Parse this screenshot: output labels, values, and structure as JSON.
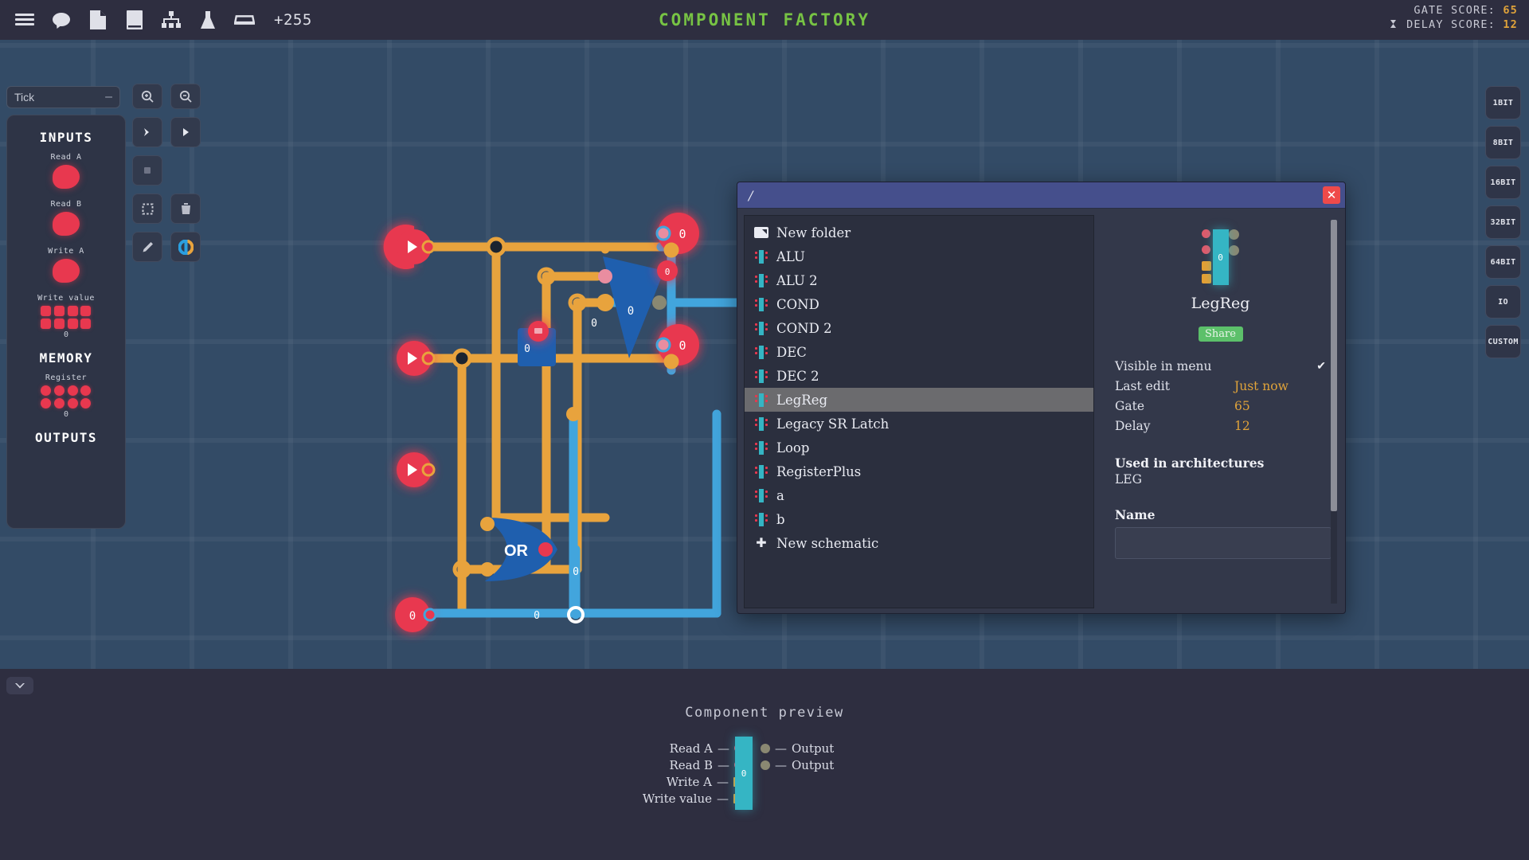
{
  "topbar": {
    "icons": [
      {
        "name": "menu-icon",
        "label": "Menu"
      },
      {
        "name": "chat-icon",
        "label": "Chat"
      },
      {
        "name": "file-icon",
        "label": "File"
      },
      {
        "name": "book-icon",
        "label": "Book"
      },
      {
        "name": "hierarchy-icon",
        "label": "Architecture"
      },
      {
        "name": "flask-icon",
        "label": "Lab"
      },
      {
        "name": "tray-icon",
        "label": "Tray"
      }
    ],
    "tray_count": "+255",
    "app_title": "COMPONENT FACTORY",
    "gate_score_label": "GATE SCORE:",
    "gate_score_value": "65",
    "delay_score_label": "DELAY SCORE:",
    "delay_score_value": "12"
  },
  "sim_panel": {
    "mode_select_value": "Tick",
    "mode_select_marker": "–",
    "inputs_title": "INPUTS",
    "memory_title": "MEMORY",
    "outputs_title": "OUTPUTS",
    "inputs": [
      {
        "label": "Read A",
        "type": "bulb"
      },
      {
        "label": "Read B",
        "type": "bulb"
      },
      {
        "label": "Write A",
        "type": "bulb"
      }
    ],
    "write_value": {
      "label": "Write value",
      "bits": 8,
      "value": "0"
    },
    "register": {
      "label": "Register",
      "bits": 8,
      "value": "0"
    }
  },
  "tools": [
    {
      "name": "zoom-in-icon",
      "label": "Zoom in"
    },
    {
      "name": "zoom-out-icon",
      "label": "Zoom out"
    },
    {
      "name": "step-icon",
      "label": "Step"
    },
    {
      "name": "play-icon",
      "label": "Play"
    },
    {
      "name": "stop-icon",
      "label": "Stop"
    },
    {
      "name": "select-icon",
      "label": "Select"
    },
    {
      "name": "delete-icon",
      "label": "Delete"
    },
    {
      "name": "pencil-icon",
      "label": "Draw"
    },
    {
      "name": "color-ring-icon",
      "label": "Color"
    }
  ],
  "bit_buttons": [
    "1BIT",
    "8BIT",
    "16BIT",
    "32BIT",
    "64BIT",
    "IO",
    "CUSTOM"
  ],
  "dialog": {
    "path": "/",
    "close_label": "✕",
    "files": [
      {
        "label": "New folder",
        "icon": "folder-icon",
        "selected": false
      },
      {
        "label": "ALU",
        "icon": "chip-icon",
        "selected": false
      },
      {
        "label": "ALU 2",
        "icon": "chip-icon",
        "selected": false
      },
      {
        "label": "COND",
        "icon": "chip-icon",
        "selected": false
      },
      {
        "label": "COND 2",
        "icon": "chip-icon",
        "selected": false
      },
      {
        "label": "DEC",
        "icon": "chip-icon",
        "selected": false
      },
      {
        "label": "DEC 2",
        "icon": "chip-icon",
        "selected": false
      },
      {
        "label": "LegReg",
        "icon": "chip-icon",
        "selected": true
      },
      {
        "label": "Legacy SR Latch",
        "icon": "chip-icon",
        "selected": false
      },
      {
        "label": "Loop",
        "icon": "chip-icon",
        "selected": false
      },
      {
        "label": "RegisterPlus",
        "icon": "chip-icon",
        "selected": false
      },
      {
        "label": "a",
        "icon": "chip-icon",
        "selected": false
      },
      {
        "label": "b",
        "icon": "chip-icon",
        "selected": false
      },
      {
        "label": "New schematic",
        "icon": "plus-icon",
        "selected": false
      }
    ],
    "detail": {
      "chip_value": "0",
      "chip_name": "LegReg",
      "share_label": "Share",
      "visible_label": "Visible in menu",
      "visible_checked": "✔",
      "last_edit_label": "Last edit",
      "last_edit_value": "Just now",
      "gate_label": "Gate",
      "gate_value": "65",
      "delay_label": "Delay",
      "delay_value": "12",
      "used_in_label": "Used in architectures",
      "used_in_value": "LEG",
      "name_label": "Name",
      "name_value": "",
      "name_placeholder": ""
    }
  },
  "bottom": {
    "preview_title": "Component preview",
    "chip_value": "0",
    "left_pins": [
      {
        "label": "Read A",
        "type": "dot-red"
      },
      {
        "label": "Read B",
        "type": "dot-red"
      },
      {
        "label": "Write A",
        "type": "square-orange"
      },
      {
        "label": "Write value",
        "type": "square-orange"
      }
    ],
    "right_pins": [
      {
        "label": "Output",
        "type": "dot-grey"
      },
      {
        "label": "Output",
        "type": "dot-grey"
      }
    ]
  },
  "circuit": {
    "gate_or_label": "OR",
    "node_values": [
      "0",
      "0",
      "0",
      "0",
      "0",
      "0",
      "0",
      "0"
    ],
    "wire_orange": "#e8a33d",
    "wire_blue": "#42a5dd",
    "gate_blue": "#1f5fae",
    "pin_red": "#e8384f"
  },
  "colors": {
    "accent_green": "#77c344",
    "accent_orange": "#e0a33a",
    "canvas_bg": "#334b66",
    "panel_bg": "#2e3446",
    "chrome_bg": "#2e2e40",
    "chip_teal": "#35b5c4"
  }
}
